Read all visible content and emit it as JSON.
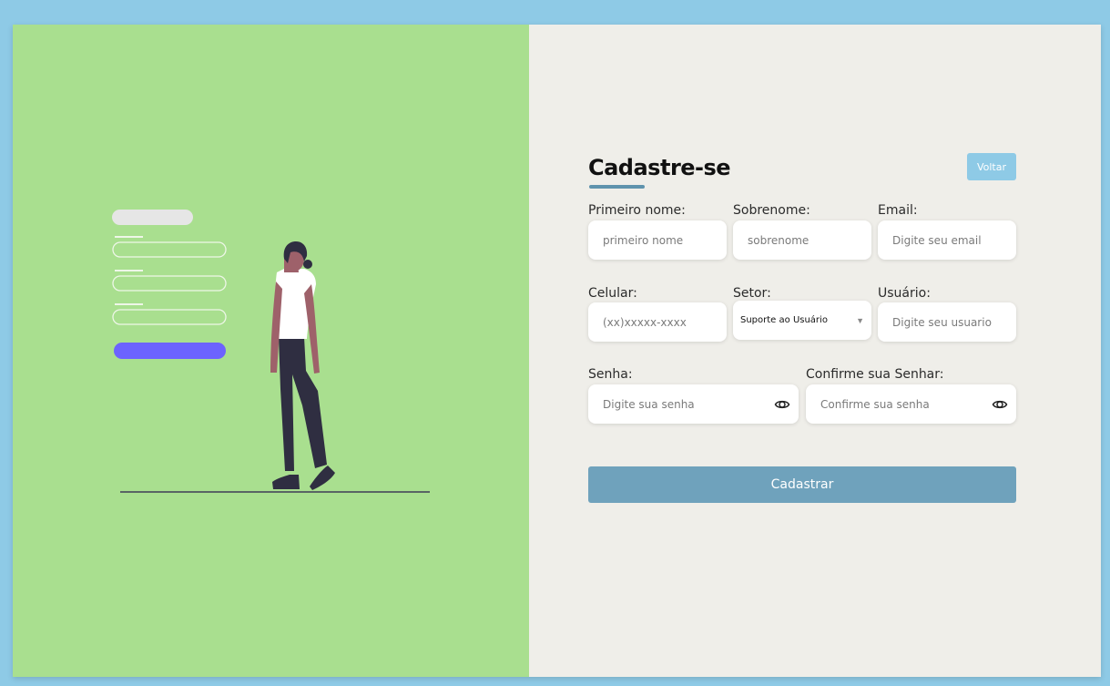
{
  "form": {
    "title": "Cadastre-se",
    "back_label": "Voltar",
    "submit_label": "Cadastrar",
    "fields": {
      "first_name": {
        "label": "Primeiro nome:",
        "placeholder": "primeiro nome"
      },
      "last_name": {
        "label": "Sobrenome:",
        "placeholder": "sobrenome"
      },
      "email": {
        "label": "Email:",
        "placeholder": "Digite seu email"
      },
      "phone": {
        "label": "Celular:",
        "placeholder": "(xx)xxxxx-xxxx"
      },
      "sector": {
        "label": "Setor:",
        "selected": "Suporte ao Usuário"
      },
      "username": {
        "label": "Usuário:",
        "placeholder": "Digite seu usuario"
      },
      "password": {
        "label": "Senha:",
        "placeholder": "Digite sua senha"
      },
      "confirm_password": {
        "label": "Confirme sua Senhar:",
        "placeholder": "Confirme sua senha"
      }
    }
  },
  "colors": {
    "page_background": "#8ecae6",
    "illustration_panel": "#a9df8f",
    "form_panel": "#efeee9",
    "accent": "#6fa2bc",
    "illustration_button": "#6c63ff"
  },
  "icons": {
    "password_toggle": "eye-icon",
    "select_caret": "caret-down-icon"
  }
}
